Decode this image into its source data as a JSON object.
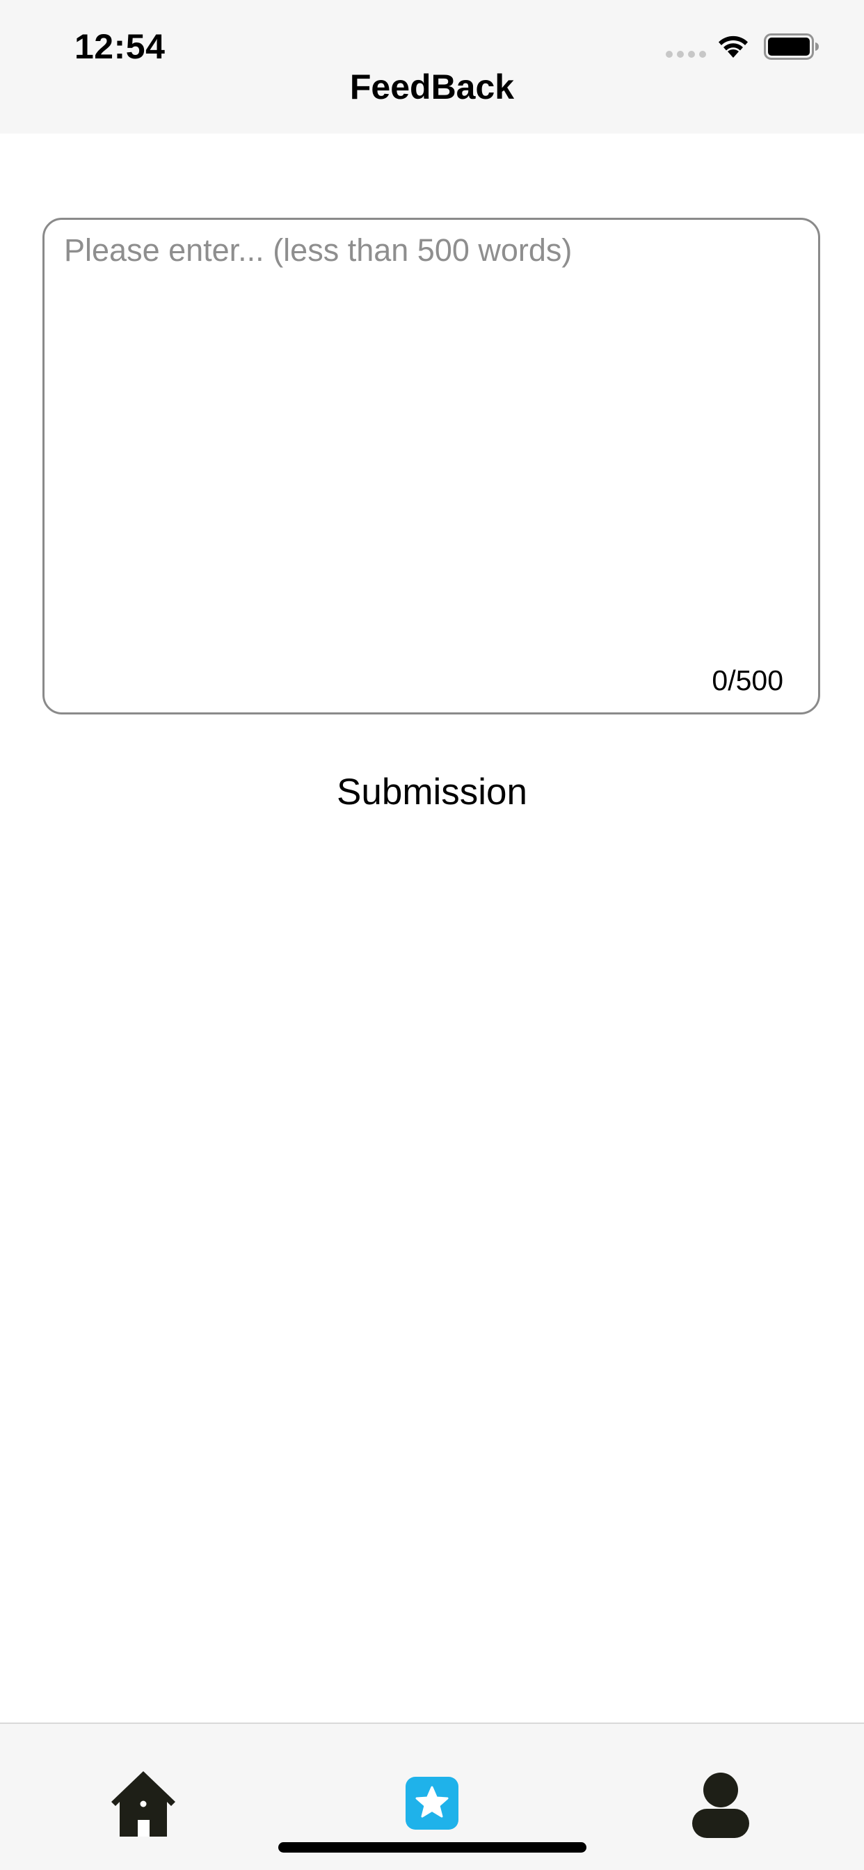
{
  "status_bar": {
    "time": "12:54",
    "wifi_icon": "wifi-icon",
    "battery_icon": "battery-icon",
    "signal_icon": "cellular-signal-dots-icon"
  },
  "nav": {
    "title": "FeedBack"
  },
  "feedback": {
    "value": "",
    "placeholder": "Please enter... (less than 500 words)",
    "counter": "0/500"
  },
  "actions": {
    "submit_label": "Submission"
  },
  "tab_bar": {
    "tabs": [
      {
        "icon": "home-icon",
        "selected": false
      },
      {
        "icon": "star-icon",
        "selected": true
      },
      {
        "icon": "person-icon",
        "selected": false
      }
    ]
  },
  "colors": {
    "accent": "#1fb2ea",
    "icon_dark": "#1e1f17",
    "bar_background": "#f6f6f6",
    "placeholder": "#8e8e8e",
    "border": "#8a8a8a"
  }
}
